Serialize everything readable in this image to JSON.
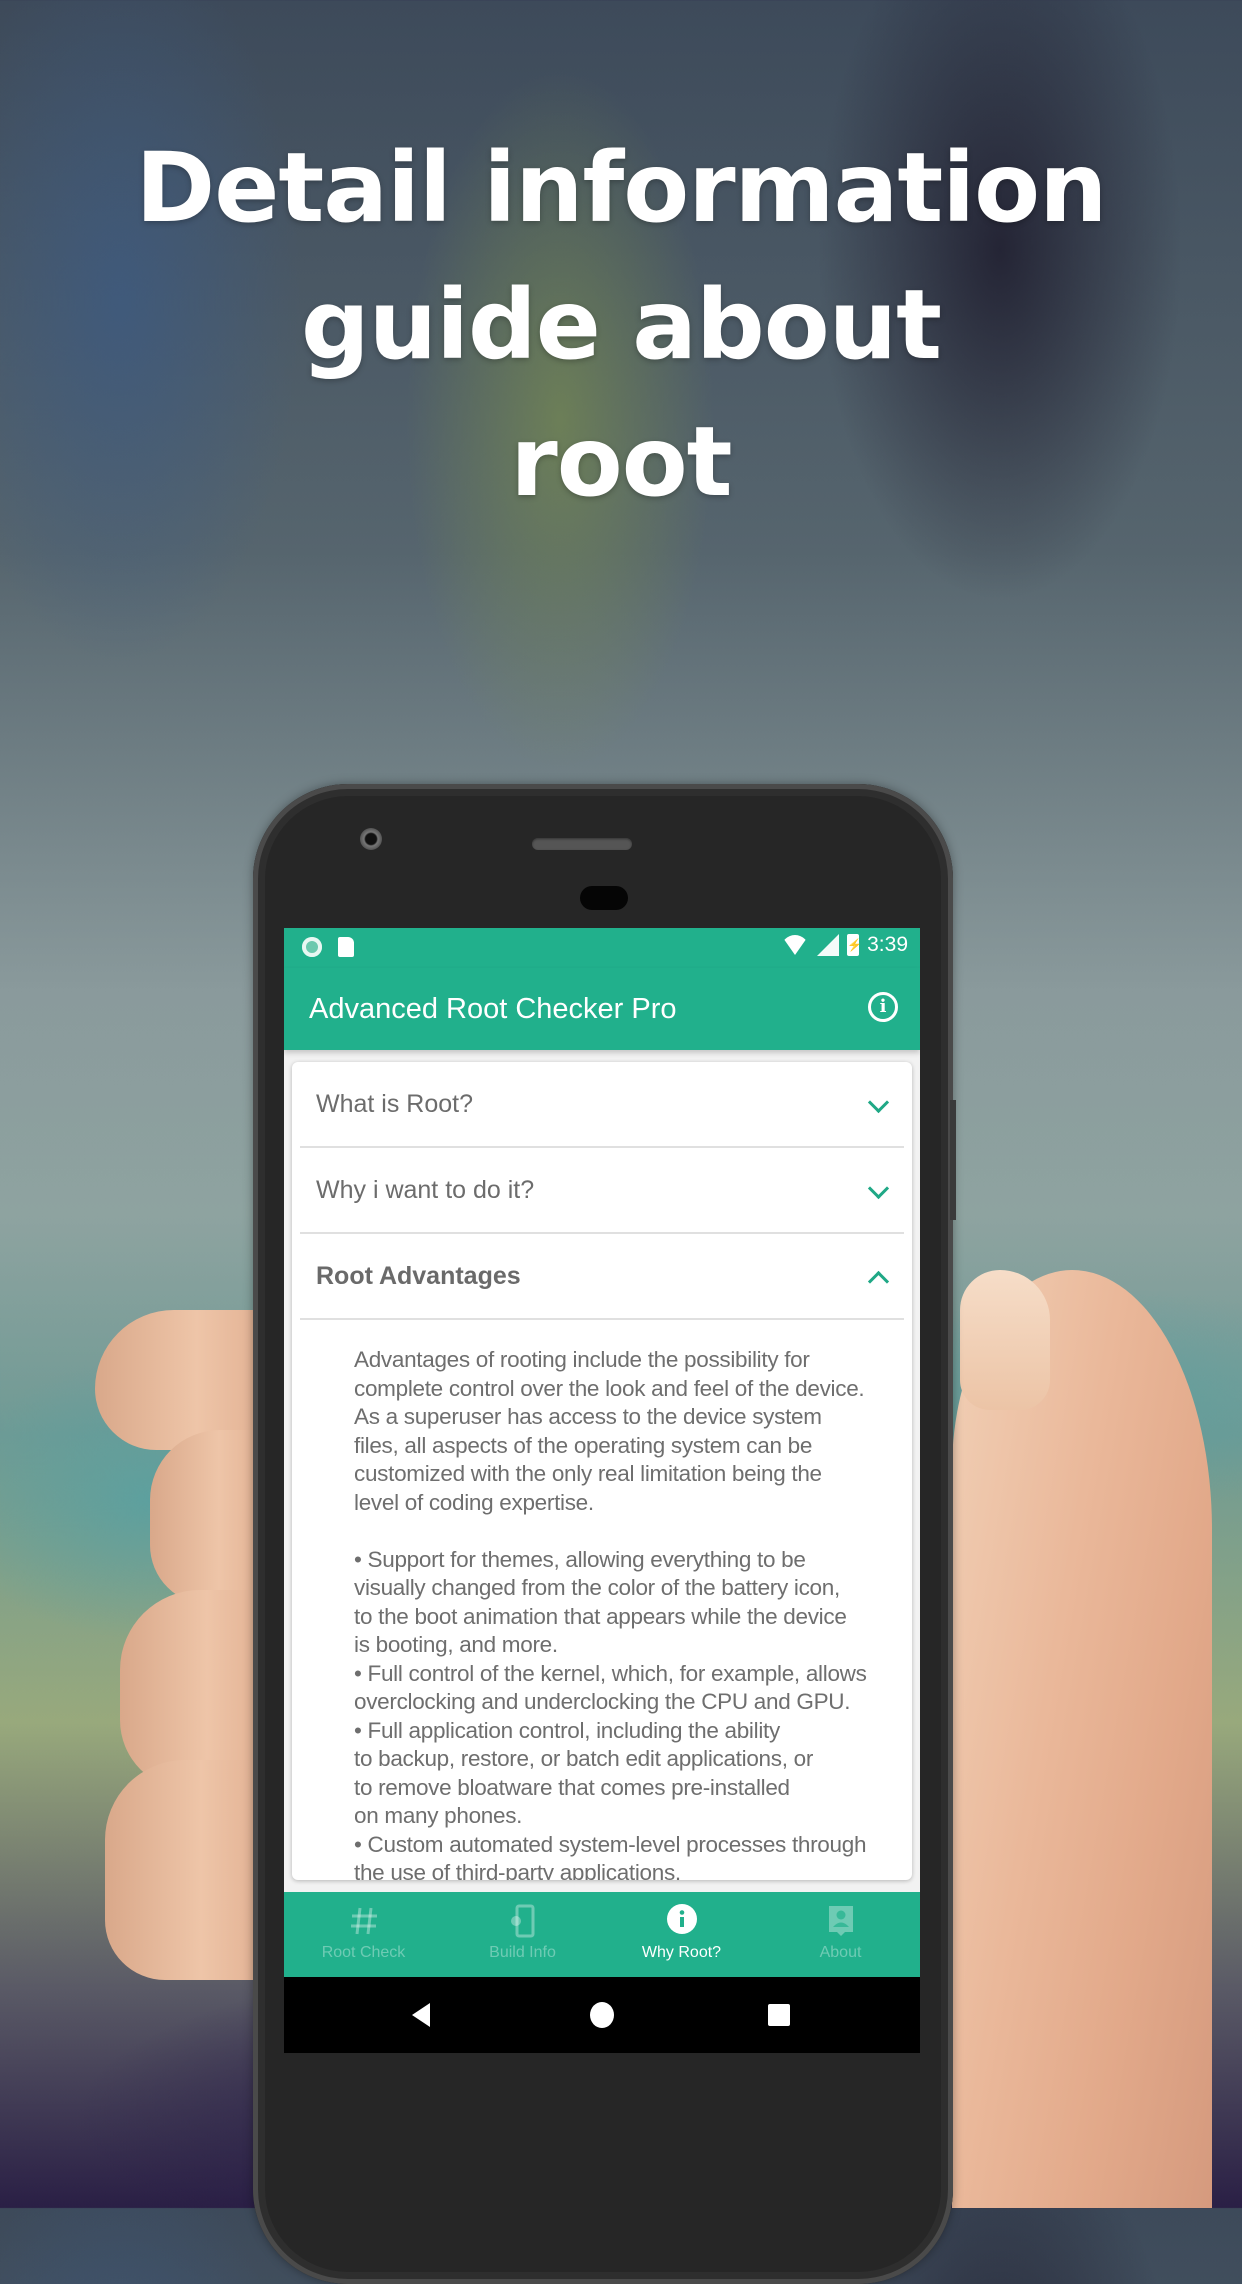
{
  "headline": {
    "lines": [
      "Detail information",
      "guide about",
      "root"
    ]
  },
  "status_bar": {
    "time": "3:39",
    "left_icons": [
      "notification-dot-icon",
      "sd-card-icon"
    ],
    "right_icons": [
      "wifi-off-icon",
      "cell-signal-icon",
      "battery-charging-icon"
    ]
  },
  "app_bar": {
    "title": "Advanced Root Checker Pro",
    "action_icon": "info-icon"
  },
  "accordion": {
    "items": [
      {
        "label": "What is Root?",
        "expanded": false,
        "icon": "chevron-down-icon"
      },
      {
        "label": "Why i want to do it?",
        "expanded": false,
        "icon": "chevron-down-icon"
      },
      {
        "label": "Root Advantages",
        "expanded": true,
        "icon": "chevron-up-icon"
      }
    ],
    "expanded_body": "Advantages of rooting include the possibility for\ncomplete control over the look and feel of the device.\nAs a superuser has access to the device system\nfiles, all aspects of the operating system can be\ncustomized with the only real limitation being the\nlevel of coding expertise.\n\n • Support for themes, allowing everything to be\nvisually changed from the color of the battery icon,\nto the boot animation that appears while the device\nis booting, and more.\n • Full control of the kernel, which, for example, allows\noverclocking and underclocking the CPU and GPU.\n • Full application control, including the ability\nto backup, restore, or batch edit applications, or\nto remove bloatware that comes pre-installed\non many phones.\n • Custom automated system-level processes through\nthe use of third-party applications."
  },
  "bottom_nav": {
    "items": [
      {
        "label": "Root Check",
        "icon": "hash-icon",
        "active": false
      },
      {
        "label": "Build Info",
        "icon": "phone-settings-icon",
        "active": false
      },
      {
        "label": "Why Root?",
        "icon": "info-icon",
        "active": true
      },
      {
        "label": "About",
        "icon": "contact-icon",
        "active": false
      }
    ]
  },
  "system_nav": {
    "buttons": [
      "back",
      "home",
      "recents"
    ]
  },
  "colors": {
    "accent": "#21b08c",
    "chevron": "#1fa886",
    "text": "#6e6e6e"
  }
}
